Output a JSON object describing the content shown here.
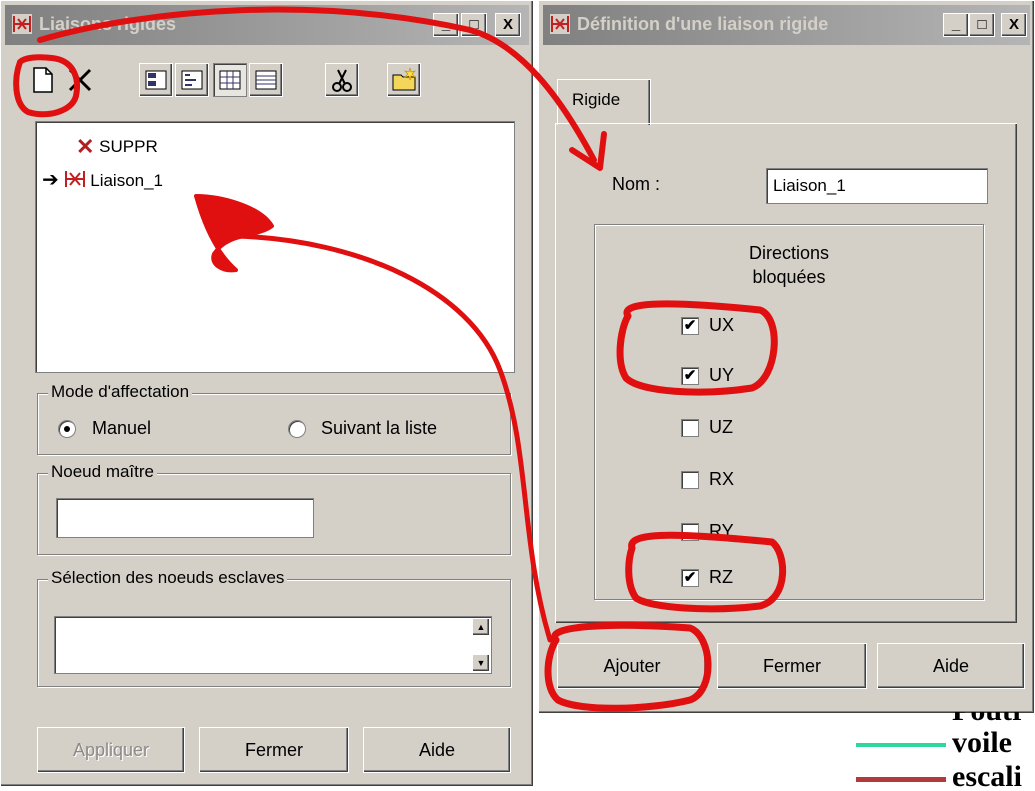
{
  "left_window": {
    "title": "Liaisons rigides",
    "toolbar_icons": [
      "new-icon",
      "delete-icon",
      "view-icon-1",
      "view-icon-2",
      "view-icon-3",
      "view-icon-4",
      "cut-icon",
      "folder-icon"
    ],
    "list_items": [
      {
        "label": "SUPPR",
        "icon": "delete-x-icon"
      },
      {
        "label": "Liaison_1",
        "icon": "rigid-link-icon"
      }
    ],
    "mode_group": {
      "label": "Mode d'affectation",
      "options": [
        "Manuel",
        "Suivant la liste"
      ],
      "selected": "Manuel"
    },
    "master_group": {
      "label": "Noeud maître",
      "value": ""
    },
    "slave_group": {
      "label": "Sélection des noeuds esclaves",
      "value": ""
    },
    "buttons": {
      "apply": "Appliquer",
      "close": "Fermer",
      "help": "Aide"
    }
  },
  "right_window": {
    "title": "Définition d'une liaison rigide",
    "tab": "Rigide",
    "name_label": "Nom :",
    "name_value": "Liaison_1",
    "directions_label_1": "Directions",
    "directions_label_2": "bloquées",
    "directions": [
      {
        "label": "UX",
        "checked": true
      },
      {
        "label": "UY",
        "checked": true
      },
      {
        "label": "UZ",
        "checked": false
      },
      {
        "label": "RX",
        "checked": false
      },
      {
        "label": "RY",
        "checked": false
      },
      {
        "label": "RZ",
        "checked": true
      }
    ],
    "buttons": {
      "add": "Ajouter",
      "close": "Fermer",
      "help": "Aide"
    }
  },
  "legend": {
    "partial_text": "Poutr",
    "entries": [
      {
        "label": "voile",
        "color": "#2fd6a0"
      },
      {
        "label": "escali",
        "color": "#b33a3a"
      }
    ]
  },
  "annotation_color": "#e01010",
  "title_buttons": {
    "minimize": "_",
    "maximize": "□",
    "close": "X"
  }
}
